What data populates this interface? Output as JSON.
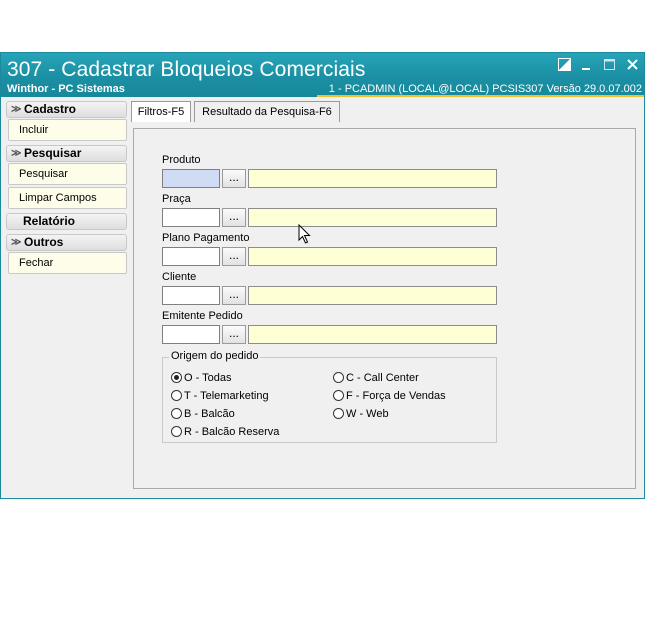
{
  "window": {
    "title": "307 - Cadastrar Bloqueios Comerciais",
    "subtitle": "Winthor - PC Sistemas",
    "status": "1 - PCADMIN (LOCAL@LOCAL)   PCSIS307  Versão  29.0.07.002"
  },
  "sidebar": {
    "cadastro": {
      "label": "Cadastro",
      "items": [
        "Incluir"
      ]
    },
    "pesquisar": {
      "label": "Pesquisar",
      "items": [
        "Pesquisar",
        "Limpar Campos"
      ]
    },
    "relatorio": {
      "label": "Relatório"
    },
    "outros": {
      "label": "Outros",
      "items": [
        "Fechar"
      ]
    }
  },
  "tabs": [
    "Filtros-F5",
    "Resultado da Pesquisa-F6"
  ],
  "filters": {
    "produto": "Produto",
    "praca": "Praça",
    "plano": "Plano Pagamento",
    "cliente": "Cliente",
    "emitente": "Emitente Pedido",
    "lookup_label": "..."
  },
  "origem": {
    "label": "Origem do pedido",
    "options": [
      "O - Todas",
      "T - Telemarketing",
      "B - Balcão",
      "R - Balcão Reserva",
      "C - Call Center",
      "F - Força de Vendas",
      "W - Web"
    ],
    "selected": "O - Todas"
  },
  "colors": {
    "titlebar": "#1b8fa3",
    "accent": "#f4c02a",
    "description_field": "#ffffd6"
  }
}
